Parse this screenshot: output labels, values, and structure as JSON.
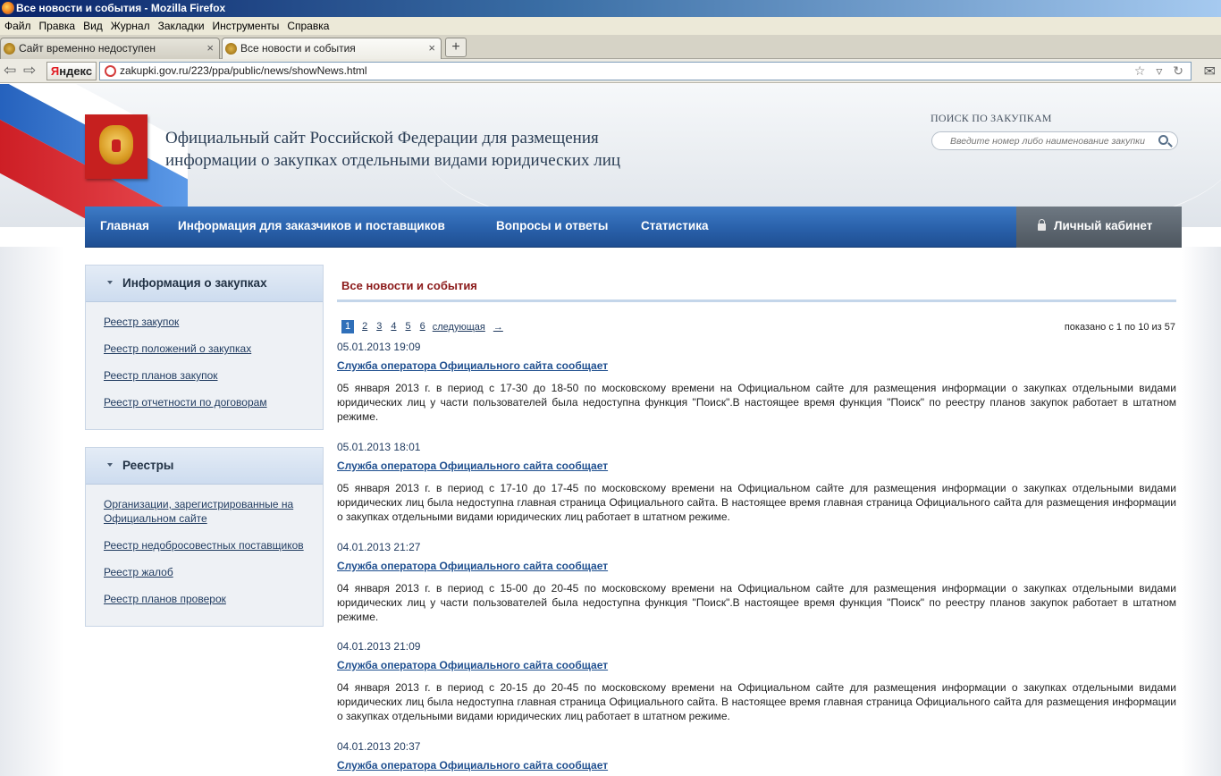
{
  "browser": {
    "window_title": "Все новости и события - Mozilla Firefox",
    "menu": [
      "Файл",
      "Правка",
      "Вид",
      "Журнал",
      "Закладки",
      "Инструменты",
      "Справка"
    ],
    "tabs": [
      {
        "label": "Сайт временно недоступен"
      },
      {
        "label": "Все новости и события"
      }
    ],
    "yandex": {
      "y": "Я",
      "rest": "ндекс"
    },
    "url": "zakupki.gov.ru/223/ppa/public/news/showNews.html"
  },
  "header": {
    "site_title": "Официальный сайт Российской Федерации для размещения информации о закупках отдельными видами юридических лиц",
    "search_caption": "ПОИСК ПО ЗАКУПКАМ",
    "search_placeholder": "Введите номер либо наименование закупки"
  },
  "nav": {
    "items": [
      "Главная",
      "Информация для заказчиков и поставщиков",
      "Вопросы и ответы",
      "Статистика"
    ],
    "cabinet": "Личный кабинет"
  },
  "sidebar": {
    "panels": [
      {
        "title": "Информация о закупках",
        "links": [
          "Реестр закупок",
          "Реестр положений о закупках",
          "Реестр планов закупок",
          "Реестр отчетности по договорам"
        ]
      },
      {
        "title": "Реестры",
        "links": [
          "Организации, зарегистрированные на Официальном сайте",
          "Реестр недобросовестных поставщиков",
          "Реестр жалоб",
          "Реестр планов проверок"
        ]
      }
    ]
  },
  "content": {
    "title": "Все новости и события",
    "pager": {
      "pages": [
        "1",
        "2",
        "3",
        "4",
        "5",
        "6"
      ],
      "current": "1",
      "next": "следующая",
      "arrow": "→"
    },
    "showing": "показано с 1 по 10 из 57",
    "news": [
      {
        "date": "05.01.2013 19:09",
        "title": "Служба оператора Официального сайта сообщает",
        "body": "05 января 2013 г. в период с 17-30 до 18-50 по московскому времени на Официальном сайте для размещения информации о закупках отдельными видами юридических лиц у части пользователей была недоступна функция \"Поиск\".В настоящее время функция \"Поиск\" по реестру планов закупок работает в штатном режиме."
      },
      {
        "date": "05.01.2013 18:01",
        "title": "Служба оператора Официального сайта сообщает",
        "body": "05 января 2013 г. в период с 17-10 до 17-45 по московскому времени на Официальном сайте для размещения информации о закупках отдельными видами юридических лиц была недоступна главная страница Официального сайта. В настоящее время главная страница Официального сайта для размещения информации о закупках отдельными видами юридических лиц работает в штатном режиме."
      },
      {
        "date": "04.01.2013 21:27",
        "title": "Служба оператора Официального сайта сообщает",
        "body": "04 января 2013 г. в период с 15-00 до 20-45 по московскому времени на Официальном сайте для размещения информации о закупках отдельными видами юридических лиц у части пользователей была недоступна функция \"Поиск\".В настоящее время функция \"Поиск\" по реестру планов закупок работает в штатном режиме."
      },
      {
        "date": "04.01.2013 21:09",
        "title": "Служба оператора Официального сайта сообщает",
        "body": "04 января 2013 г. в период с 20-15 до 20-45 по московскому времени на Официальном сайте для размещения информации о закупках отдельными видами юридических лиц была недоступна главная страница Официального сайта. В настоящее время главная страница Официального сайта для размещения информации о закупках отдельными видами юридических лиц работает в штатном режиме."
      },
      {
        "date": "04.01.2013 20:37",
        "title": "Служба оператора Официального сайта сообщает",
        "body": ""
      }
    ]
  }
}
